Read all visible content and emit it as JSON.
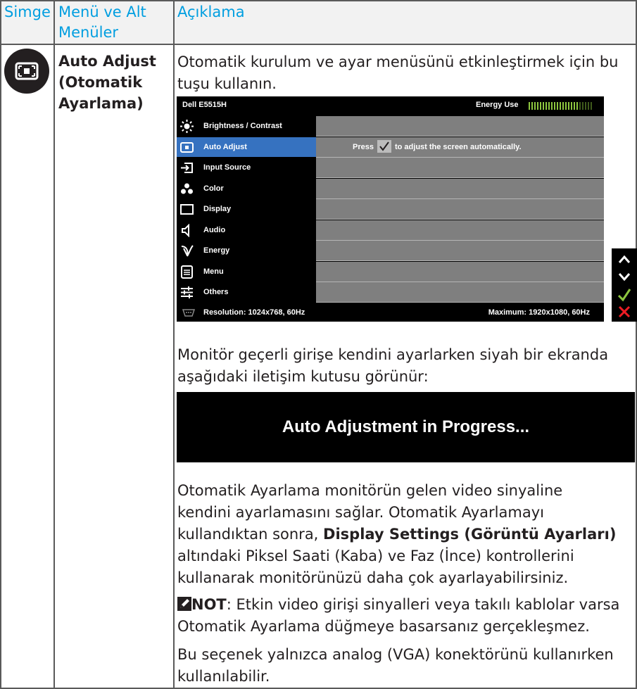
{
  "header": {
    "col1": "Simge",
    "col2_line1": "Menü ve Alt",
    "col2_line2": "Menüler",
    "col3": "Açıklama"
  },
  "row": {
    "icon": "auto-adjust-icon",
    "menu_line1": "Auto Adjust",
    "menu_line2": "(Otomatik",
    "menu_line3": "Ayarlama)",
    "desc1_line1": "Otomatik kurulum ve ayar menüsünü etkinleştirmek için bu",
    "desc1_line2": "tuşu kullanın.",
    "desc2_line1": "Monitör geçerli girişe kendini ayarlarken siyah bir ekranda",
    "desc2_line2": "aşağıdaki iletişim kutusu görünür:",
    "desc3_line1": "Otomatik Ayarlama monitörün gelen video sinyaline",
    "desc3_line2": "kendini ayarlamasını sağlar. Otomatik Ayarlamayı",
    "desc3_line3_pre": "kullandıktan sonra, ",
    "desc3_line3_bold": "Display Settings (Görüntü Ayarları)",
    "desc3_line4": "altındaki Piksel Saati (Kaba) ve Faz (İnce) kontrollerini",
    "desc3_line5": "kullanarak monitörünüzü daha çok ayarlayabilirsiniz.",
    "note_label": "NOT",
    "note_line1_rest": ": Etkin video girişi sinyalleri veya takılı kablolar varsa",
    "note_line2": "Otomatik Ayarlama düğmeye basarsanız gerçekleşmez.",
    "desc4_line1": "Bu seçenek yalnızca analog (VGA) konektörünü kullanırken",
    "desc4_line2": "kullanılabilir."
  },
  "osd": {
    "title": "Dell E5515H",
    "energy_label": "Energy Use",
    "energy_level": 0.78,
    "menu_items": [
      {
        "label": "Brightness / Contrast",
        "icon": "brightness-icon"
      },
      {
        "label": "Auto Adjust",
        "icon": "auto-adjust-icon",
        "selected": true
      },
      {
        "label": "Input Source",
        "icon": "input-source-icon"
      },
      {
        "label": "Color",
        "icon": "color-icon"
      },
      {
        "label": "Display",
        "icon": "display-icon"
      },
      {
        "label": "Audio",
        "icon": "audio-icon"
      },
      {
        "label": "Energy",
        "icon": "energy-icon"
      },
      {
        "label": "Menu",
        "icon": "menu-icon"
      },
      {
        "label": "Others",
        "icon": "others-icon"
      }
    ],
    "press_pre": "Press",
    "press_post": "to adjust the screen automatically.",
    "resolution": "Resolution: 1024x768, 60Hz",
    "maximum": "Maximum: 1920x1080, 60Hz",
    "buttons": [
      "up-arrow-icon",
      "down-arrow-icon",
      "check-icon",
      "close-icon"
    ]
  },
  "progress_dialog": {
    "text": "Auto Adjustment in Progress..."
  },
  "colors": {
    "header_text": "#009ee0",
    "osd_selected": "#3672c0",
    "osd_panel": "#7f7f7f",
    "check_green": "#8dc63f",
    "close_red": "#ed1c24"
  }
}
